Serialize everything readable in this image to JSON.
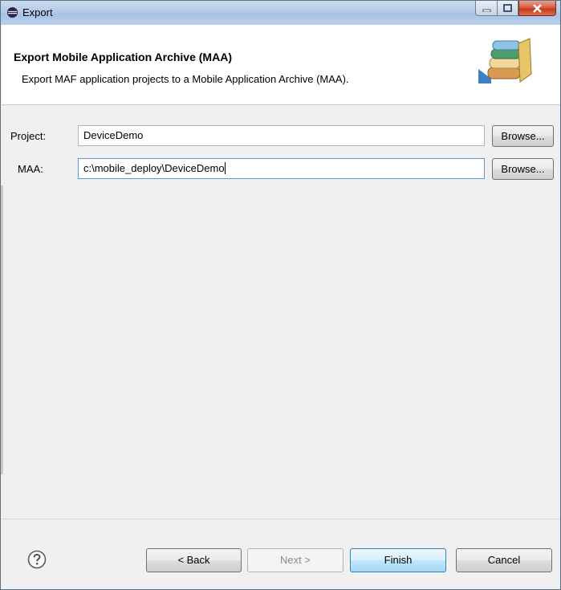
{
  "window": {
    "title": "Export"
  },
  "header": {
    "title": "Export Mobile Application Archive (MAA)",
    "description": "Export MAF application projects to a Mobile Application Archive (MAA)."
  },
  "form": {
    "project_label": "Project:",
    "project_value": "DeviceDemo",
    "maa_label": "MAA:",
    "maa_value": "c:\\mobile_deploy\\DeviceDemo",
    "browse_label": "Browse..."
  },
  "footer": {
    "back_label": "< Back",
    "next_label": "Next >",
    "finish_label": "Finish",
    "cancel_label": "Cancel"
  },
  "icons": {
    "app": "eclipse-icon",
    "minimize": "minimize-icon",
    "maximize": "maximize-icon",
    "close": "close-icon",
    "banner": "archive-books-icon",
    "help": "help-icon"
  },
  "colors": {
    "default_button_border": "#3c7fb1",
    "close_button": "#c3371c",
    "focus_border": "#5b9bd5"
  }
}
